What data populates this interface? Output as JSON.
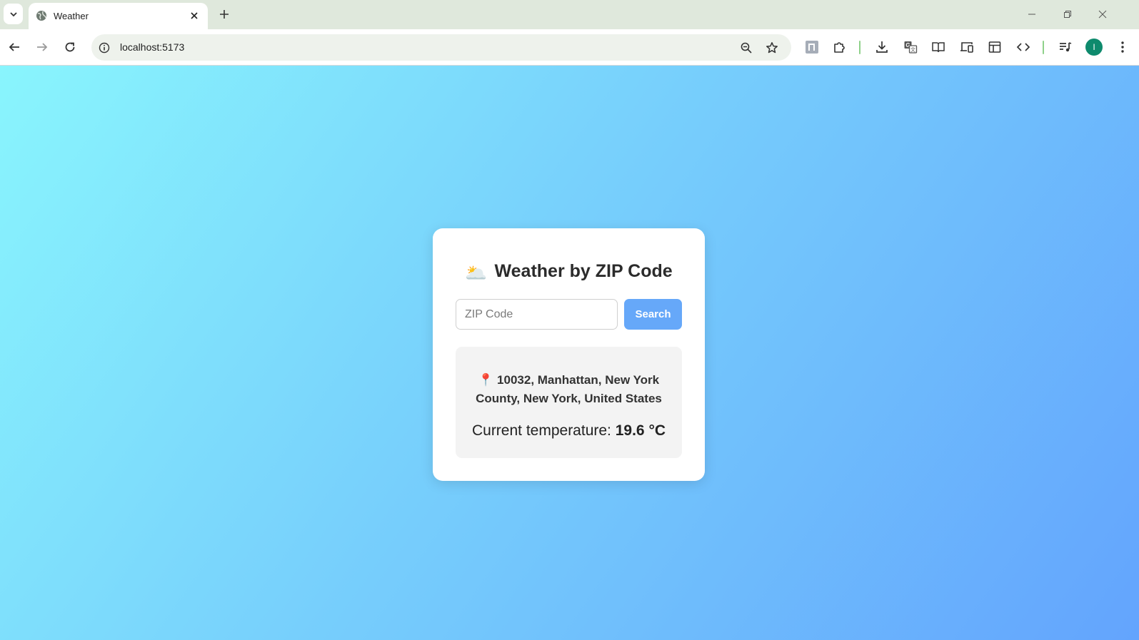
{
  "browser": {
    "tab": {
      "title": "Weather"
    },
    "url": "localhost:5173",
    "profile_initial": "I"
  },
  "page": {
    "title": "Weather by ZIP Code",
    "title_emoji": "🌥️",
    "zip_input": {
      "placeholder": "ZIP Code",
      "value": ""
    },
    "search_button_label": "Search",
    "result": {
      "pin_emoji": "📍",
      "location": "10032, Manhattan, New York County, New York, United States",
      "temp_label": "Current temperature:",
      "temp_value": "19.6 °C"
    }
  },
  "colors": {
    "accent": "#66a8f9",
    "gradient_start": "#89f5fd",
    "gradient_end": "#63a4fd"
  }
}
